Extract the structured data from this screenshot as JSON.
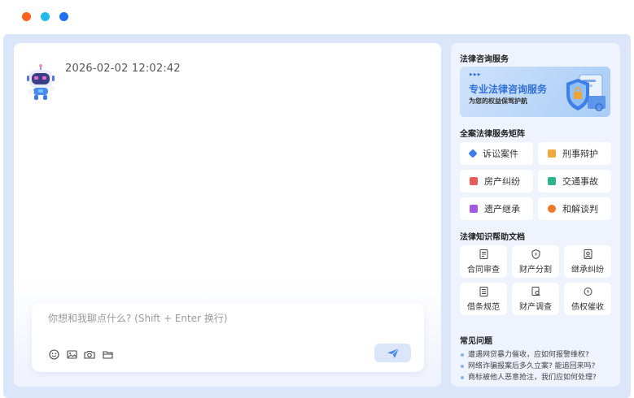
{
  "window": {
    "dots": [
      "#ff5f1f",
      "#21b8ea",
      "#1f6ff0"
    ]
  },
  "chat": {
    "timestamp": "2026-02-02 12:02:42",
    "input_placeholder": "你想和我聊点什么? (Shift + Enter 换行)",
    "tools": [
      "emoji-icon",
      "image-icon",
      "camera-icon",
      "folder-icon"
    ],
    "send_icon": "send-icon"
  },
  "sidebar": {
    "consult": {
      "title": "法律咨询服务",
      "banner_title": "专业法律咨询服务",
      "banner_subtitle": "为您的权益保驾护航"
    },
    "services": {
      "title": "全案法律服务矩阵",
      "items": [
        {
          "label": "诉讼案件",
          "icon": "gavel-icon",
          "color": "#3f7fe8"
        },
        {
          "label": "刑事辩护",
          "icon": "shield-icon",
          "color": "#f2a93b"
        },
        {
          "label": "房产纠纷",
          "icon": "house-icon",
          "color": "#ec5b5b"
        },
        {
          "label": "交通事故",
          "icon": "car-icon",
          "color": "#2fb58a"
        },
        {
          "label": "遗产继承",
          "icon": "inheritance-icon",
          "color": "#a259e6"
        },
        {
          "label": "和解谈判",
          "icon": "handshake-icon",
          "color": "#f07a2a"
        }
      ]
    },
    "docs": {
      "title": "法律知识帮助文档",
      "items": [
        {
          "label": "合同审查",
          "icon": "contract-icon"
        },
        {
          "label": "财产分割",
          "icon": "property-icon"
        },
        {
          "label": "继承纠纷",
          "icon": "inherit-doc-icon"
        },
        {
          "label": "借条规范",
          "icon": "iou-icon"
        },
        {
          "label": "财产调查",
          "icon": "investigate-icon"
        },
        {
          "label": "债权催收",
          "icon": "debt-icon"
        }
      ]
    },
    "faq": {
      "title": "常见问题",
      "items": [
        "遭遇网贷暴力催收，应如何报警维权?",
        "网络诈骗报案后多久立案? 能追回来吗?",
        "商标被他人恶意抢注，我们应如何处理?"
      ]
    }
  }
}
